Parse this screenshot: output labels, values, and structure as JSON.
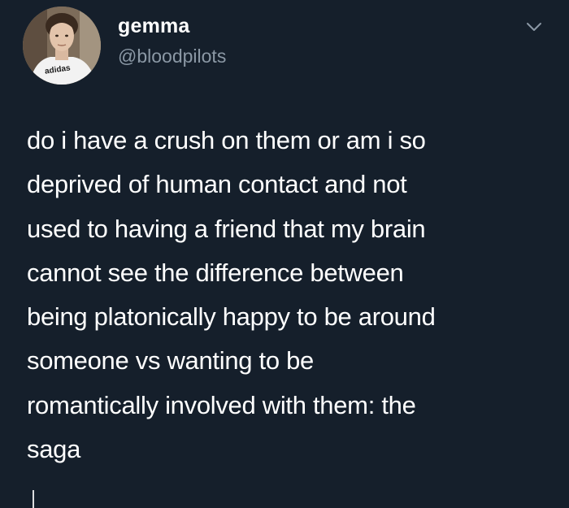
{
  "tweet": {
    "display_name": "gemma",
    "handle": "@bloodpilots",
    "text": "do i have a crush on them or am i so\ndeprived of human contact and not\nused to having a friend that my brain\ncannot see the difference between\nbeing platonically happy to be around\nsomeone vs wanting to be\nromantically involved with them: the\nsaga",
    "avatar_shirt_text": "adidas"
  },
  "icons": {
    "more": "chevron-down-icon"
  },
  "colors": {
    "background": "#151f2b",
    "text_primary": "#ffffff",
    "text_secondary": "#8b98a5"
  }
}
